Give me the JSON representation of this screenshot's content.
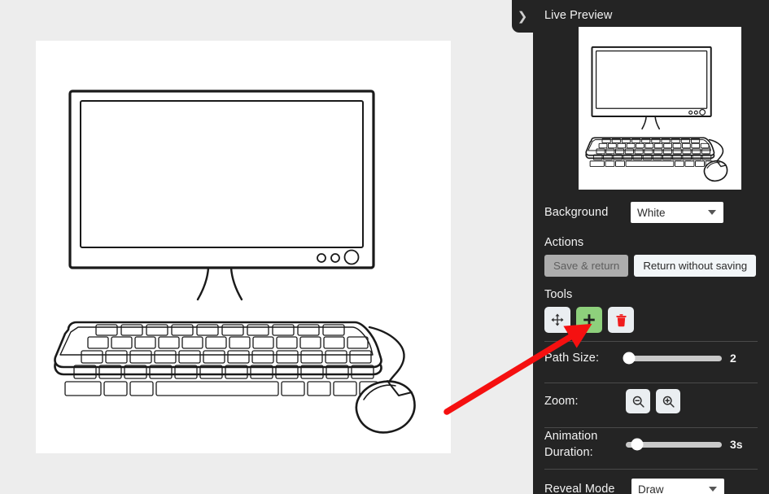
{
  "sidebar": {
    "collapse_icon": "chevron-right-icon",
    "title": "Live Preview",
    "preview_alt": "desktop-computer-line-drawing",
    "background": {
      "label": "Background",
      "value": "White"
    },
    "actions": {
      "heading": "Actions",
      "save_label": "Save & return",
      "return_label": "Return without saving"
    },
    "tools": {
      "heading": "Tools",
      "items": [
        {
          "name": "move-tool",
          "icon": "move-arrows-icon",
          "active": false
        },
        {
          "name": "add-point-tool",
          "icon": "plus-icon",
          "active": true
        },
        {
          "name": "delete-tool",
          "icon": "trash-icon",
          "active": false
        }
      ]
    },
    "path_size": {
      "label": "Path Size:",
      "value": "2",
      "thumb_percent": 3
    },
    "zoom": {
      "label": "Zoom:",
      "out_icon": "magnifier-minus-icon",
      "in_icon": "magnifier-plus-icon"
    },
    "animation_duration": {
      "label_line1": "Animation",
      "label_line2": "Duration:",
      "value": "3s",
      "thumb_percent": 12
    },
    "reveal_mode": {
      "label": "Reveal Mode",
      "value": "Draw"
    }
  },
  "canvas": {
    "name": "drawing-canvas",
    "illustration": "desktop-computer-with-keyboard-and-mouse"
  },
  "annotation": {
    "name": "red-pointer-arrow",
    "color": "#f51010",
    "points_to": "add-point-tool"
  },
  "colors": {
    "page_background": "#ededed",
    "sidebar_background": "#242424",
    "canvas_background": "#ffffff",
    "accent_green": "#8ed07c",
    "arrow_red": "#f51010",
    "trash_red": "#f01c1c"
  }
}
